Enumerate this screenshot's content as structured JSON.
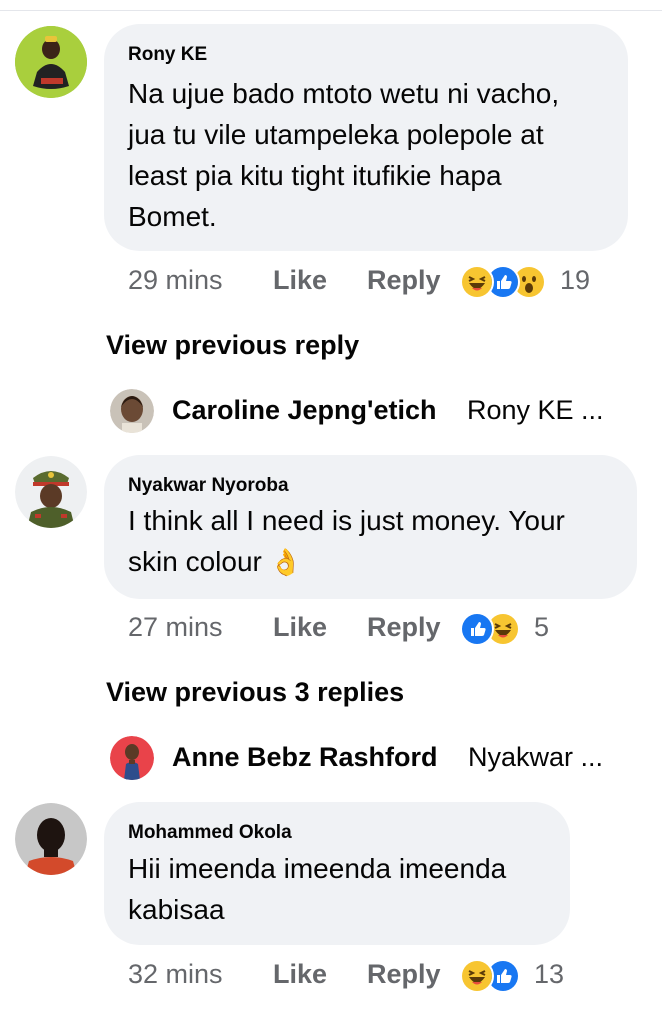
{
  "comments": [
    {
      "author": "Rony KE",
      "text": "Na ujue bado mtoto wetu ni vacho,\njua tu vile utampeleka polepole at\nleast pia kitu tight itufikie hapa\nBomet.",
      "time": "29 mins",
      "like_label": "Like",
      "reply_label": "Reply",
      "reactions": [
        "haha-icon",
        "like-icon",
        "wow-icon"
      ],
      "reaction_count": "19"
    },
    {
      "author": "Nyakwar Nyoroba",
      "text": "I think all I need is just money. Your\nskin colour",
      "emoji": "👌",
      "time": "27 mins",
      "like_label": "Like",
      "reply_label": "Reply",
      "reactions": [
        "like-icon",
        "haha-icon"
      ],
      "reaction_count": "5"
    },
    {
      "author": "Mohammed Okola",
      "text": "Hii imeenda imeenda imeenda\nkabisaa",
      "time": "32 mins",
      "like_label": "Like",
      "reply_label": "Reply",
      "reactions": [
        "haha-icon",
        "like-icon"
      ],
      "reaction_count": "13"
    }
  ],
  "view_previous": [
    {
      "label": "View previous reply"
    },
    {
      "label": "View previous 3 replies"
    }
  ],
  "reply_previews": [
    {
      "name": "Caroline Jepng'etich",
      "preview": "Rony KE ..."
    },
    {
      "name": "Anne Bebz Rashford",
      "preview": "Nyakwar ..."
    }
  ],
  "colors": {
    "bubble": "#f0f2f5",
    "meta_text": "#65676b",
    "like_blue": "#1877f2",
    "haha_yellow": "#f7c531"
  }
}
